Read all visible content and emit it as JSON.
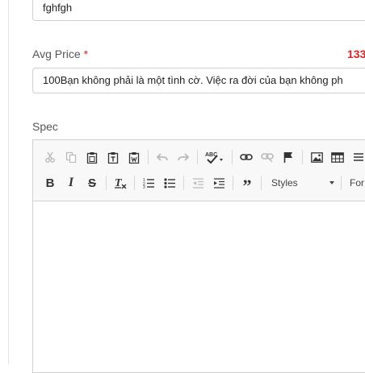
{
  "name_field": {
    "value": "fghfgh"
  },
  "price_field": {
    "label": "Avg Price",
    "required_marker": "*",
    "counter": "133",
    "value": "100Bạn không phải là một tình cờ.  Việc ra đời của bạn không ph"
  },
  "spec_field": {
    "label": "Spec",
    "styles_label": "Styles",
    "format_label": "For",
    "content": ""
  },
  "colors": {
    "required": "#e02424",
    "toolbar_bg": "#f8f8f8"
  }
}
